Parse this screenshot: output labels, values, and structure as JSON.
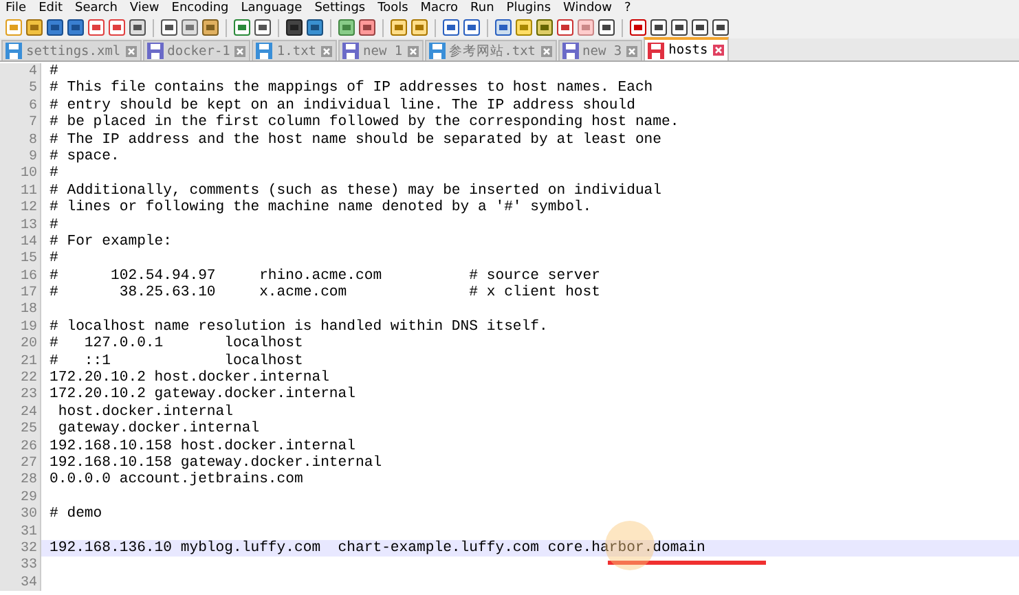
{
  "menu": [
    "File",
    "Edit",
    "Search",
    "View",
    "Encoding",
    "Language",
    "Settings",
    "Tools",
    "Macro",
    "Run",
    "Plugins",
    "Window",
    "?"
  ],
  "tabs": [
    {
      "label": "settings.xml",
      "selected": false,
      "color": "#3a8fd8"
    },
    {
      "label": "docker-1",
      "selected": false,
      "color": "#6a6ac8"
    },
    {
      "label": "1.txt",
      "selected": false,
      "color": "#3a8fd8"
    },
    {
      "label": "new 1",
      "selected": false,
      "color": "#6a6ac8"
    },
    {
      "label": "参考网站.txt",
      "selected": false,
      "color": "#3a8fd8"
    },
    {
      "label": "new 3",
      "selected": false,
      "color": "#6a6ac8"
    },
    {
      "label": "hosts",
      "selected": true,
      "color": "#e03040"
    }
  ],
  "lines": [
    {
      "number": "4",
      "text": "#",
      "current": false
    },
    {
      "number": "5",
      "text": "# This file contains the mappings of IP addresses to host names. Each",
      "current": false
    },
    {
      "number": "6",
      "text": "# entry should be kept on an individual line. The IP address should",
      "current": false
    },
    {
      "number": "7",
      "text": "# be placed in the first column followed by the corresponding host name.",
      "current": false
    },
    {
      "number": "8",
      "text": "# The IP address and the host name should be separated by at least one",
      "current": false
    },
    {
      "number": "9",
      "text": "# space.",
      "current": false
    },
    {
      "number": "10",
      "text": "#",
      "current": false
    },
    {
      "number": "11",
      "text": "# Additionally, comments (such as these) may be inserted on individual",
      "current": false
    },
    {
      "number": "12",
      "text": "# lines or following the machine name denoted by a '#' symbol.",
      "current": false
    },
    {
      "number": "13",
      "text": "#",
      "current": false
    },
    {
      "number": "14",
      "text": "# For example:",
      "current": false
    },
    {
      "number": "15",
      "text": "#",
      "current": false
    },
    {
      "number": "16",
      "text": "#      102.54.94.97     rhino.acme.com          # source server",
      "current": false
    },
    {
      "number": "17",
      "text": "#       38.25.63.10     x.acme.com              # x client host",
      "current": false
    },
    {
      "number": "18",
      "current": false
    },
    {
      "number": "19",
      "text": "# localhost name resolution is handled within DNS itself.",
      "current": false
    },
    {
      "number": "20",
      "text": "#   127.0.0.1       localhost",
      "current": false
    },
    {
      "number": "21",
      "text": "#   ::1             localhost",
      "current": false
    },
    {
      "number": "22",
      "text": "172.20.10.2 host.docker.internal",
      "current": false
    },
    {
      "number": "23",
      "text": "172.20.10.2 gateway.docker.internal",
      "current": false
    },
    {
      "number": "24",
      "text": " host.docker.internal",
      "current": false
    },
    {
      "number": "25",
      "text": " gateway.docker.internal",
      "current": false
    },
    {
      "number": "26",
      "text": "192.168.10.158 host.docker.internal",
      "current": false
    },
    {
      "number": "27",
      "text": "192.168.10.158 gateway.docker.internal",
      "current": false
    },
    {
      "number": "28",
      "text": "0.0.0.0 account.jetbrains.com",
      "current": false
    },
    {
      "number": "29",
      "current": false
    },
    {
      "number": "30",
      "text": "# demo",
      "current": false
    },
    {
      "number": "31",
      "current": false
    },
    {
      "number": "32",
      "text": "192.168.136.10 myblog.luffy.com  chart-example.luffy.com core.harbor.domain",
      "current": true
    },
    {
      "number": "33",
      "current": false
    },
    {
      "number": "34",
      "current": false
    }
  ]
}
